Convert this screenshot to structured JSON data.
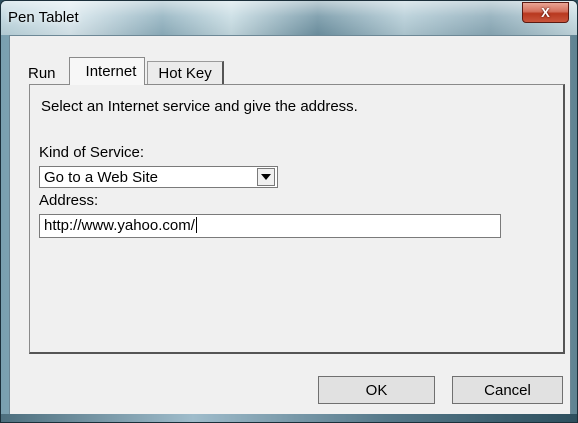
{
  "window": {
    "title": "Pen Tablet",
    "close_label": "X"
  },
  "tabs": [
    {
      "label": "Run"
    },
    {
      "label": "Internet"
    },
    {
      "label": "Hot Key"
    }
  ],
  "panel": {
    "instruction": "Select an Internet service and give the address.",
    "kind_label": "Kind of Service:",
    "kind_value": "Go to a Web Site",
    "address_label": "Address:",
    "address_value": "http://www.yahoo.com/"
  },
  "buttons": {
    "ok": "OK",
    "cancel": "Cancel"
  }
}
